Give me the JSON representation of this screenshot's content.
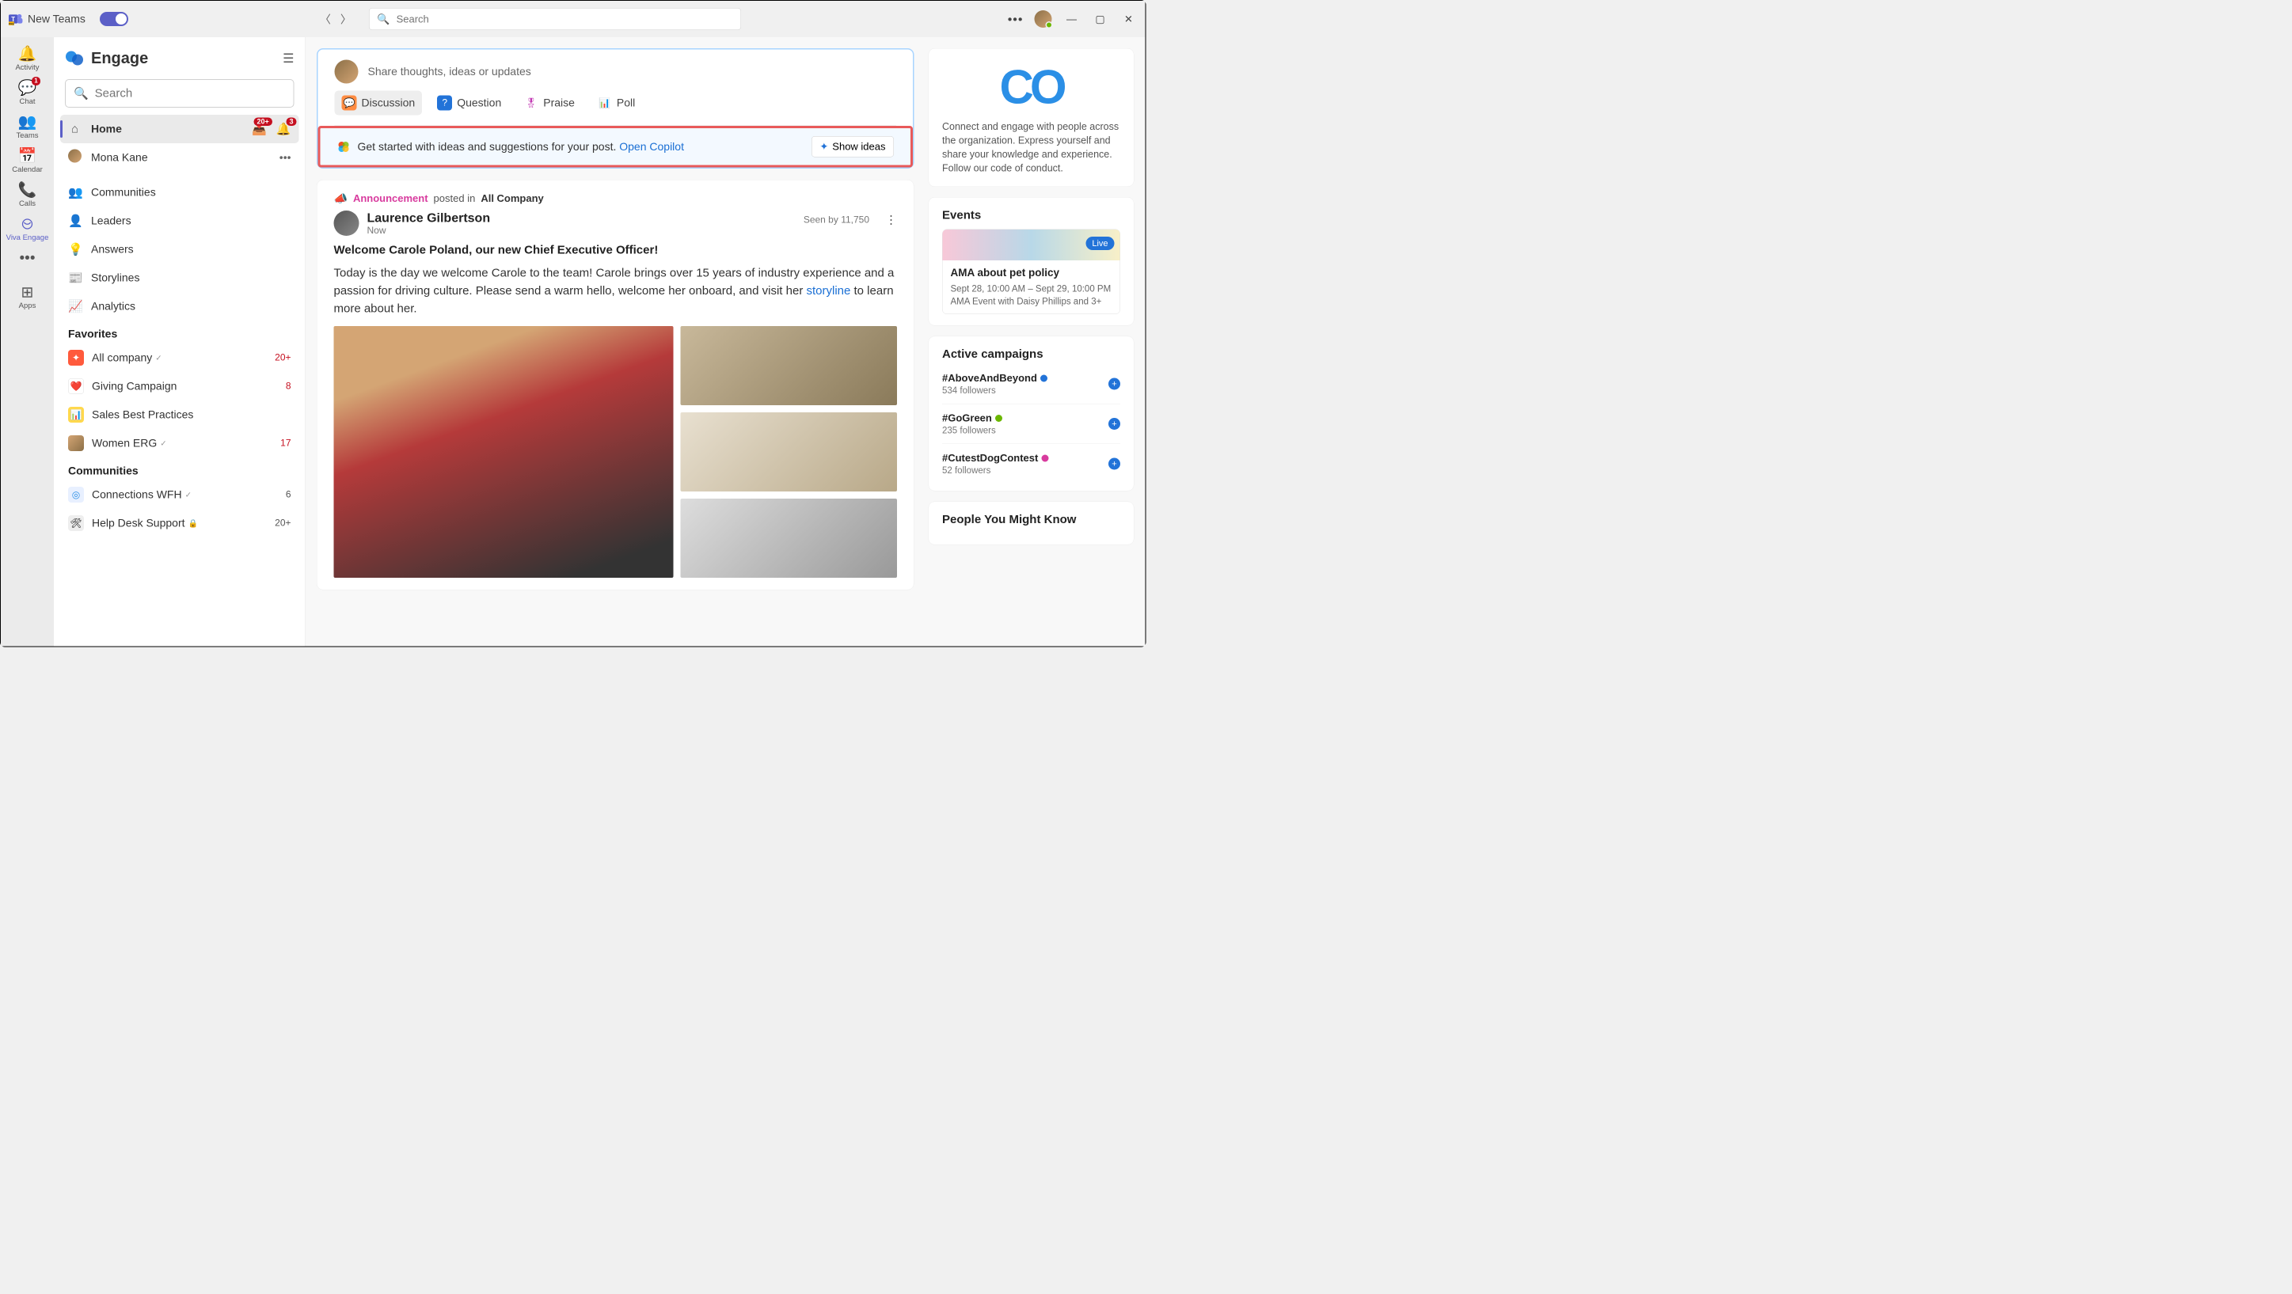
{
  "titlebar": {
    "brand": "New Teams",
    "search_placeholder": "Search"
  },
  "apprail": [
    {
      "id": "activity",
      "label": "Activity"
    },
    {
      "id": "chat",
      "label": "Chat",
      "badge": "1"
    },
    {
      "id": "teams",
      "label": "Teams"
    },
    {
      "id": "calendar",
      "label": "Calendar"
    },
    {
      "id": "calls",
      "label": "Calls"
    },
    {
      "id": "viva-engage",
      "label": "Viva Engage"
    },
    {
      "id": "apps",
      "label": "Apps"
    }
  ],
  "engage": {
    "title": "Engage",
    "search_placeholder": "Search",
    "nav": {
      "home": "Home",
      "inbox_badge": "20+",
      "bell_badge": "3",
      "user": "Mona Kane",
      "communities": "Communities",
      "leaders": "Leaders",
      "answers": "Answers",
      "storylines": "Storylines",
      "analytics": "Analytics"
    },
    "favorites_header": "Favorites",
    "favorites": [
      {
        "label": "All company",
        "count": "20+",
        "color": "#ff5a3c"
      },
      {
        "label": "Giving Campaign",
        "count": "8",
        "color": "#fff"
      },
      {
        "label": "Sales Best Practices",
        "count": "",
        "color": "#ffd84d"
      },
      {
        "label": "Women ERG",
        "count": "17",
        "color": "#d4a574"
      }
    ],
    "communities_header": "Communities",
    "communities": [
      {
        "label": "Connections WFH",
        "count": "6"
      },
      {
        "label": "Help Desk Support",
        "count": "20+"
      }
    ]
  },
  "composer": {
    "placeholder": "Share thoughts, ideas or updates",
    "tabs": {
      "discussion": "Discussion",
      "question": "Question",
      "praise": "Praise",
      "poll": "Poll"
    },
    "copilot_text": "Get started with ideas and suggestions for your post.",
    "copilot_link": "Open Copilot",
    "show_ideas": "Show ideas"
  },
  "post": {
    "tag": "Announcement",
    "posted_in": "posted in",
    "community": "All Company",
    "author": "Laurence Gilbertson",
    "time": "Now",
    "seen": "Seen by 11,750",
    "title": "Welcome Carole Poland, our new Chief Executive Officer!",
    "body_pre": "Today is the day we welcome Carole to the team! Carole brings over 15 years of industry experience and a passion for driving culture. Please send a warm hello, welcome her onboard, and visit her ",
    "body_link": "storyline",
    "body_post": " to learn more about her."
  },
  "rail": {
    "about": "Connect and engage with people across the organization. Express yourself and share your knowledge and experience. Follow our code of conduct.",
    "events_header": "Events",
    "event": {
      "live": "Live",
      "title": "AMA about pet policy",
      "date": "Sept 28, 10:00 AM – Sept 29, 10:00 PM",
      "desc": "AMA Event with Daisy Phillips and 3+"
    },
    "campaigns_header": "Active campaigns",
    "campaigns": [
      {
        "tag": "#AboveAndBeyond",
        "followers": "534 followers",
        "badge": "#2273d8"
      },
      {
        "tag": "#GoGreen",
        "followers": "235 followers",
        "badge": "#6bb700"
      },
      {
        "tag": "#CutestDogContest",
        "followers": "52 followers",
        "badge": "#d83b9e"
      }
    ],
    "people_header": "People You Might Know"
  }
}
